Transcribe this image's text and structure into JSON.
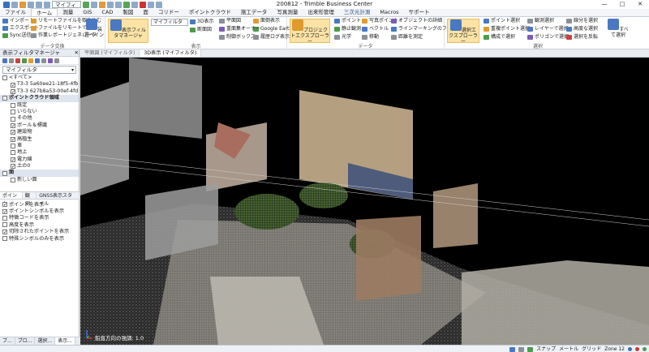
{
  "app": {
    "title": "200812 - Trimble Business Center",
    "filter_combo": "マイフィルタ"
  },
  "window_buttons": [
    "—",
    "□",
    "✕"
  ],
  "menu_tabs": [
    "ファイル",
    "ホーム",
    "測量",
    "GIS",
    "CAD",
    "製図",
    "面",
    "コリドー",
    "ポイントクラウド",
    "施工データ",
    "写真測量",
    "出来形管理",
    "三次元計測",
    "Macros",
    "サポート"
  ],
  "active_tab_index": 1,
  "ribbon": {
    "g1": {
      "items": [
        "インポート",
        "エクスポート",
        "Sync送信",
        "リモートファイルを取り込む",
        "ファイルをリモートで保存",
        "作業レポートジェネレータ"
      ],
      "big": "装置ペイン",
      "label": "データ交換"
    },
    "g2": {
      "big": "表示フィルタマネージャ",
      "combo": "マイフィルタ",
      "items": [
        "3D表示",
        "断面図",
        "平面図",
        "制御ボックス",
        "面倒表示",
        "Google Earth",
        "履歴ログ表示",
        "重面集オーナー"
      ],
      "label": "表示"
    },
    "g3": {
      "big": "プロジェクトエクスプローラー",
      "items": [
        "ポイント",
        "静止観測",
        "光学",
        "写真ポイント",
        "ベクトル",
        "移動",
        "オブジェクトの詳細",
        "ラインマーキングのフィルター",
        "距離を測定"
      ],
      "label": "データ"
    },
    "g4": {
      "big": "選択エクスプローラー",
      "items": [
        "ポイント選択",
        "重複ポイント選択",
        "構成で選択",
        "観測選択",
        "レイヤーで選択",
        "ポリゴンで選択",
        "線分を選択",
        "高度な選択",
        "選択を反転"
      ],
      "big2": "すべて選択",
      "label": "選択"
    }
  },
  "left_panel": {
    "title": "表示フィルタマネージャ",
    "filter": "マイフィルタ",
    "tree": [
      {
        "label": "<すべて>",
        "checked": false,
        "indent": 0,
        "section": false
      },
      {
        "label": "T3-3 5a60ee21-18f5-4fb",
        "checked": true,
        "indent": 2,
        "section": false
      },
      {
        "label": "T3-3 627b8a53-00ef-4fd",
        "checked": true,
        "indent": 2,
        "section": false
      },
      {
        "label": "ポイントクラウド領域",
        "checked": false,
        "indent": 0,
        "section": true
      },
      {
        "label": "既定",
        "checked": false,
        "indent": 2,
        "section": false
      },
      {
        "label": "いらない",
        "checked": false,
        "indent": 2,
        "section": false
      },
      {
        "label": "その他",
        "checked": false,
        "indent": 2,
        "section": false
      },
      {
        "label": "ポール＆標識",
        "checked": true,
        "indent": 2,
        "section": false
      },
      {
        "label": "建設物",
        "checked": true,
        "indent": 2,
        "section": false
      },
      {
        "label": "高植生",
        "checked": true,
        "indent": 2,
        "section": false
      },
      {
        "label": "車",
        "checked": false,
        "indent": 2,
        "section": false
      },
      {
        "label": "地上",
        "checked": false,
        "indent": 2,
        "section": false
      },
      {
        "label": "電力線",
        "checked": true,
        "indent": 2,
        "section": false
      },
      {
        "label": "土の0",
        "checked": true,
        "indent": 2,
        "section": false
      },
      {
        "label": "面",
        "checked": false,
        "indent": 0,
        "section": true
      },
      {
        "label": "新しい面",
        "checked": false,
        "indent": 2,
        "section": false
      }
    ],
    "tabs": [
      "ポイント",
      "観測",
      "GNSS表示スタイル"
    ],
    "options": [
      {
        "label": "ポイントを表示",
        "checked": true
      },
      {
        "label": "ポイントシンボルを表示",
        "checked": true
      },
      {
        "label": "特徴コードを表示",
        "checked": false
      },
      {
        "label": "高度を表示",
        "checked": false
      },
      {
        "label": "切除されたポイントを表示",
        "checked": true
      },
      {
        "label": "特殊シンボルのみを表示",
        "checked": false
      }
    ],
    "bottom_tabs": [
      "ブ...",
      "プロ...",
      "選択...",
      "表示..."
    ]
  },
  "doc_tabs": [
    "平面図 (マイフィルタ)",
    "3D表示 (マイフィルタ)"
  ],
  "active_doc_tab": 1,
  "viewport": {
    "scale_text": "鉛直方向の強調: 1.0"
  },
  "status_bar": {
    "items": [
      "スナップ",
      "メートル",
      "グリッド",
      "Zone 12"
    ]
  }
}
